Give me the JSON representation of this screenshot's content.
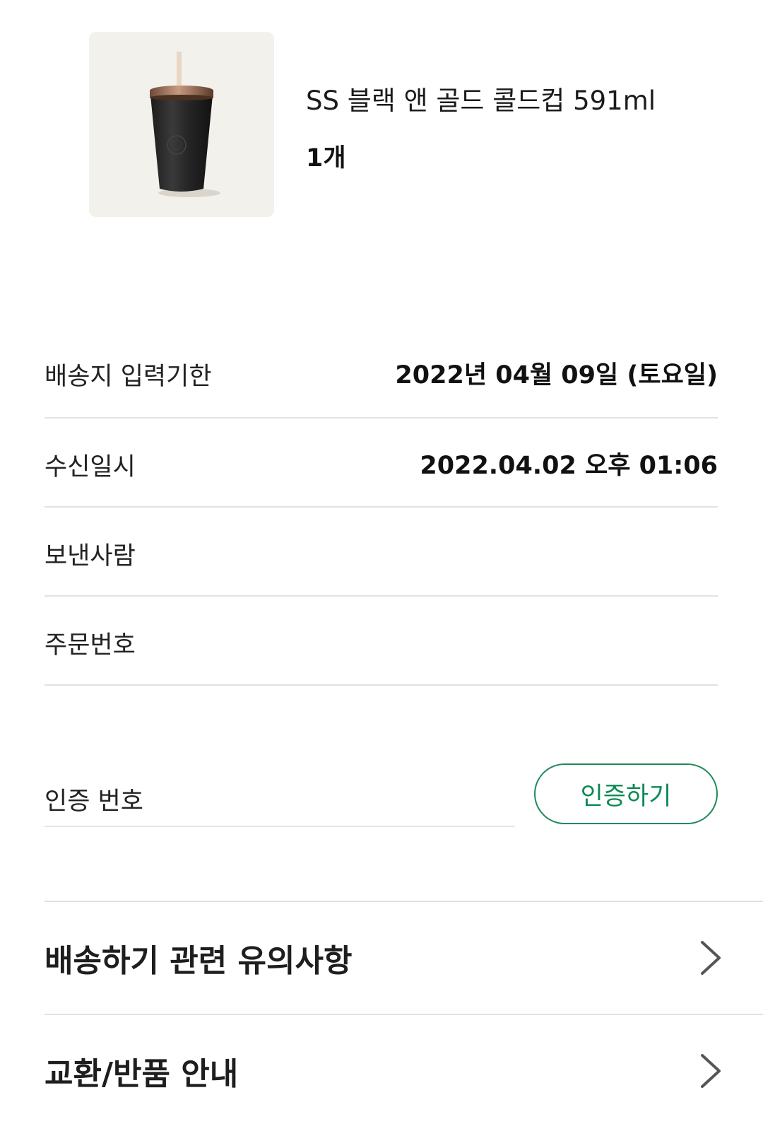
{
  "product": {
    "image_icon": "tumbler-product-image",
    "name": "SS 블랙 앤 골드 콜드컵 591ml",
    "quantity": "1개"
  },
  "info": [
    {
      "label": "배송지 입력기한",
      "value": "2022년 04월 09일 (토요일)"
    },
    {
      "label": "수신일시",
      "value": "2022.04.02 오후 01:06"
    },
    {
      "label": "보낸사람",
      "value": ""
    },
    {
      "label": "주문번호",
      "value": ""
    }
  ],
  "auth": {
    "placeholder": "인증 번호",
    "button_label": "인증하기"
  },
  "notices": [
    {
      "label": "배송하기 관련 유의사항",
      "icon": "chevron-right-icon"
    },
    {
      "label": "교환/반품 안내",
      "icon": "chevron-right-icon"
    }
  ],
  "colors": {
    "accent_green": "#0e8a55",
    "divider": "#e2e2e2",
    "thumb_background": "#f3f1ec"
  }
}
